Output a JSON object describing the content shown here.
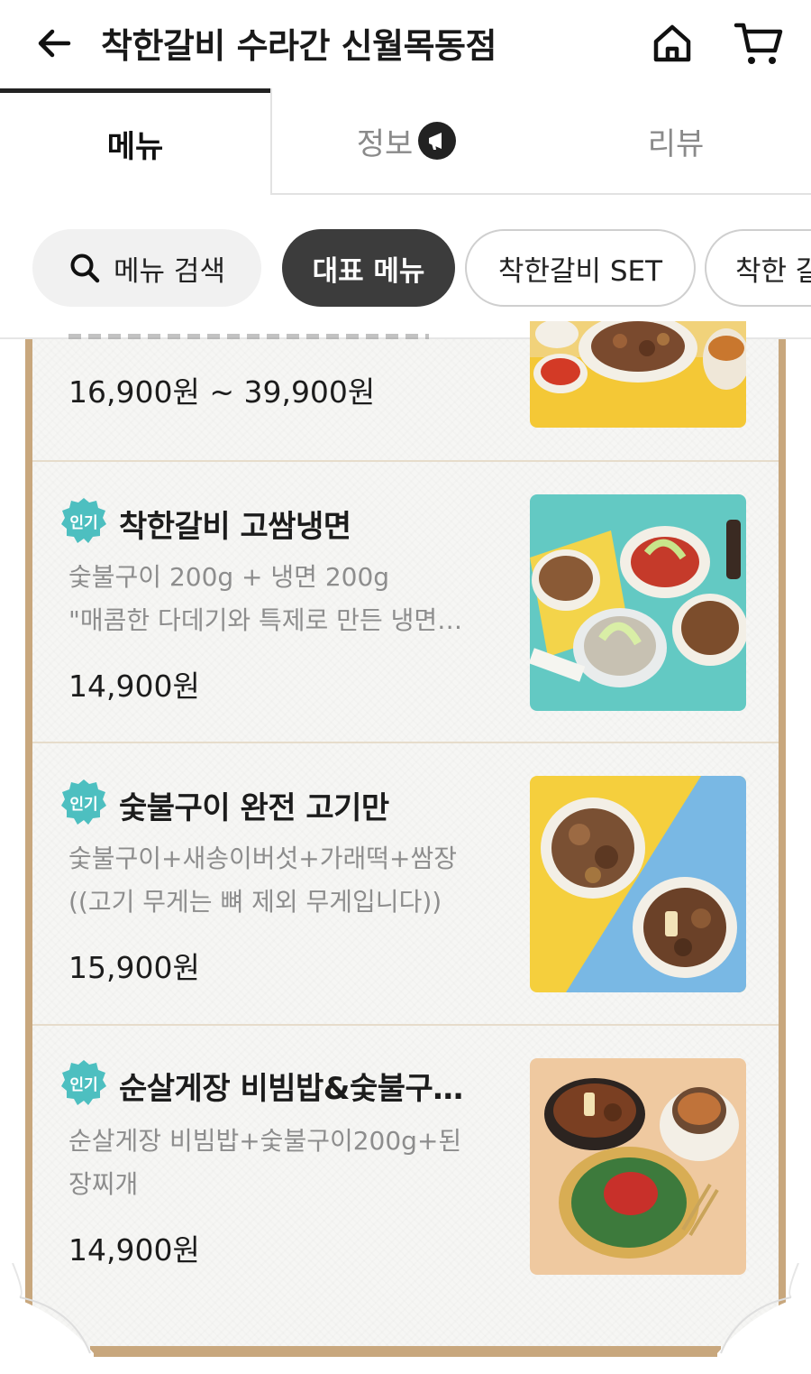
{
  "header": {
    "title": "착한갈비 수라간 신월목동점"
  },
  "tabs": [
    {
      "label": "메뉴"
    },
    {
      "label": "정보"
    },
    {
      "label": "리뷰"
    }
  ],
  "chips": {
    "search": "메뉴 검색",
    "representative": "대표 메뉴",
    "set": "착한갈비 SET",
    "next": "착한 갈"
  },
  "menu": {
    "badge_label": "인기",
    "items": [
      {
        "price": "16,900원 ~ 39,900원"
      },
      {
        "name": "착한갈비 고쌈냉면",
        "desc1": "숯불구이 200g + 냉면 200g",
        "desc2": "\"매콤한 다데기와 특제로 만든 냉면…",
        "price": "14,900원"
      },
      {
        "name": "숯불구이 완전 고기만",
        "desc1": "숯불구이+새송이버섯+가래떡+쌈장",
        "desc2": "((고기 무게는 뼈 제외 무게입니다))",
        "price": "15,900원"
      },
      {
        "name": "순살게장 비빔밥&숯불구…",
        "desc1": "순살게장 비빔밥+숯불구이200g+된",
        "desc2": "장찌개",
        "price": "14,900원"
      }
    ]
  },
  "colors": {
    "badge": "#4dbfc0",
    "chip_active": "#3c3c3c",
    "board_frame": "#c8a77d"
  }
}
